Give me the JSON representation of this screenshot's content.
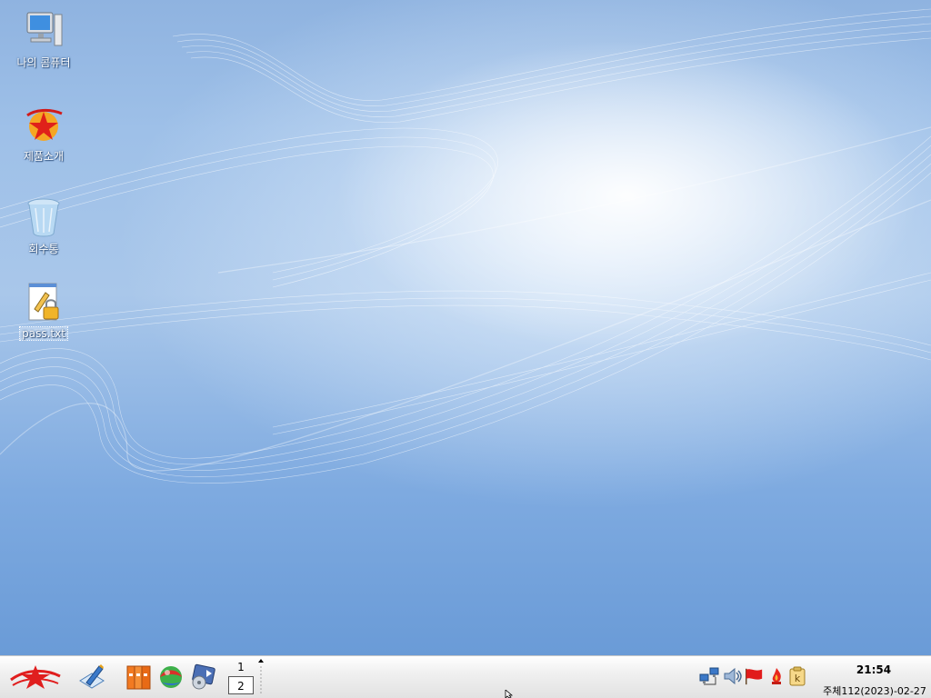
{
  "desktop": {
    "icons": [
      {
        "label": "나의 콤퓨터",
        "icon": "computer-icon"
      },
      {
        "label": "제품소개",
        "icon": "product-intro-icon"
      },
      {
        "label": "회수통",
        "icon": "trash-icon"
      },
      {
        "label": "pass.txt",
        "icon": "locked-text-file-icon",
        "selected": true
      }
    ]
  },
  "taskbar": {
    "launchers": [
      {
        "icon": "red-star-menu-icon"
      },
      {
        "icon": "text-editor-icon"
      },
      {
        "icon": "file-manager-icon"
      },
      {
        "icon": "web-browser-icon"
      },
      {
        "icon": "media-player-icon"
      }
    ],
    "pager": {
      "desktops": [
        "1",
        "2"
      ],
      "active": "2"
    },
    "tray": [
      {
        "icon": "network-icon"
      },
      {
        "icon": "volume-icon"
      },
      {
        "icon": "red-flag-icon"
      },
      {
        "icon": "flame-icon"
      },
      {
        "icon": "keyboard-layout-icon"
      }
    ],
    "clock": {
      "time": "21:54",
      "date": "주체112(2023)-02-27"
    }
  },
  "colors": {
    "wallpaper_blue": "#8fb3e0",
    "taskbar_bg": "#ececec",
    "label_text": "#ffffff"
  }
}
